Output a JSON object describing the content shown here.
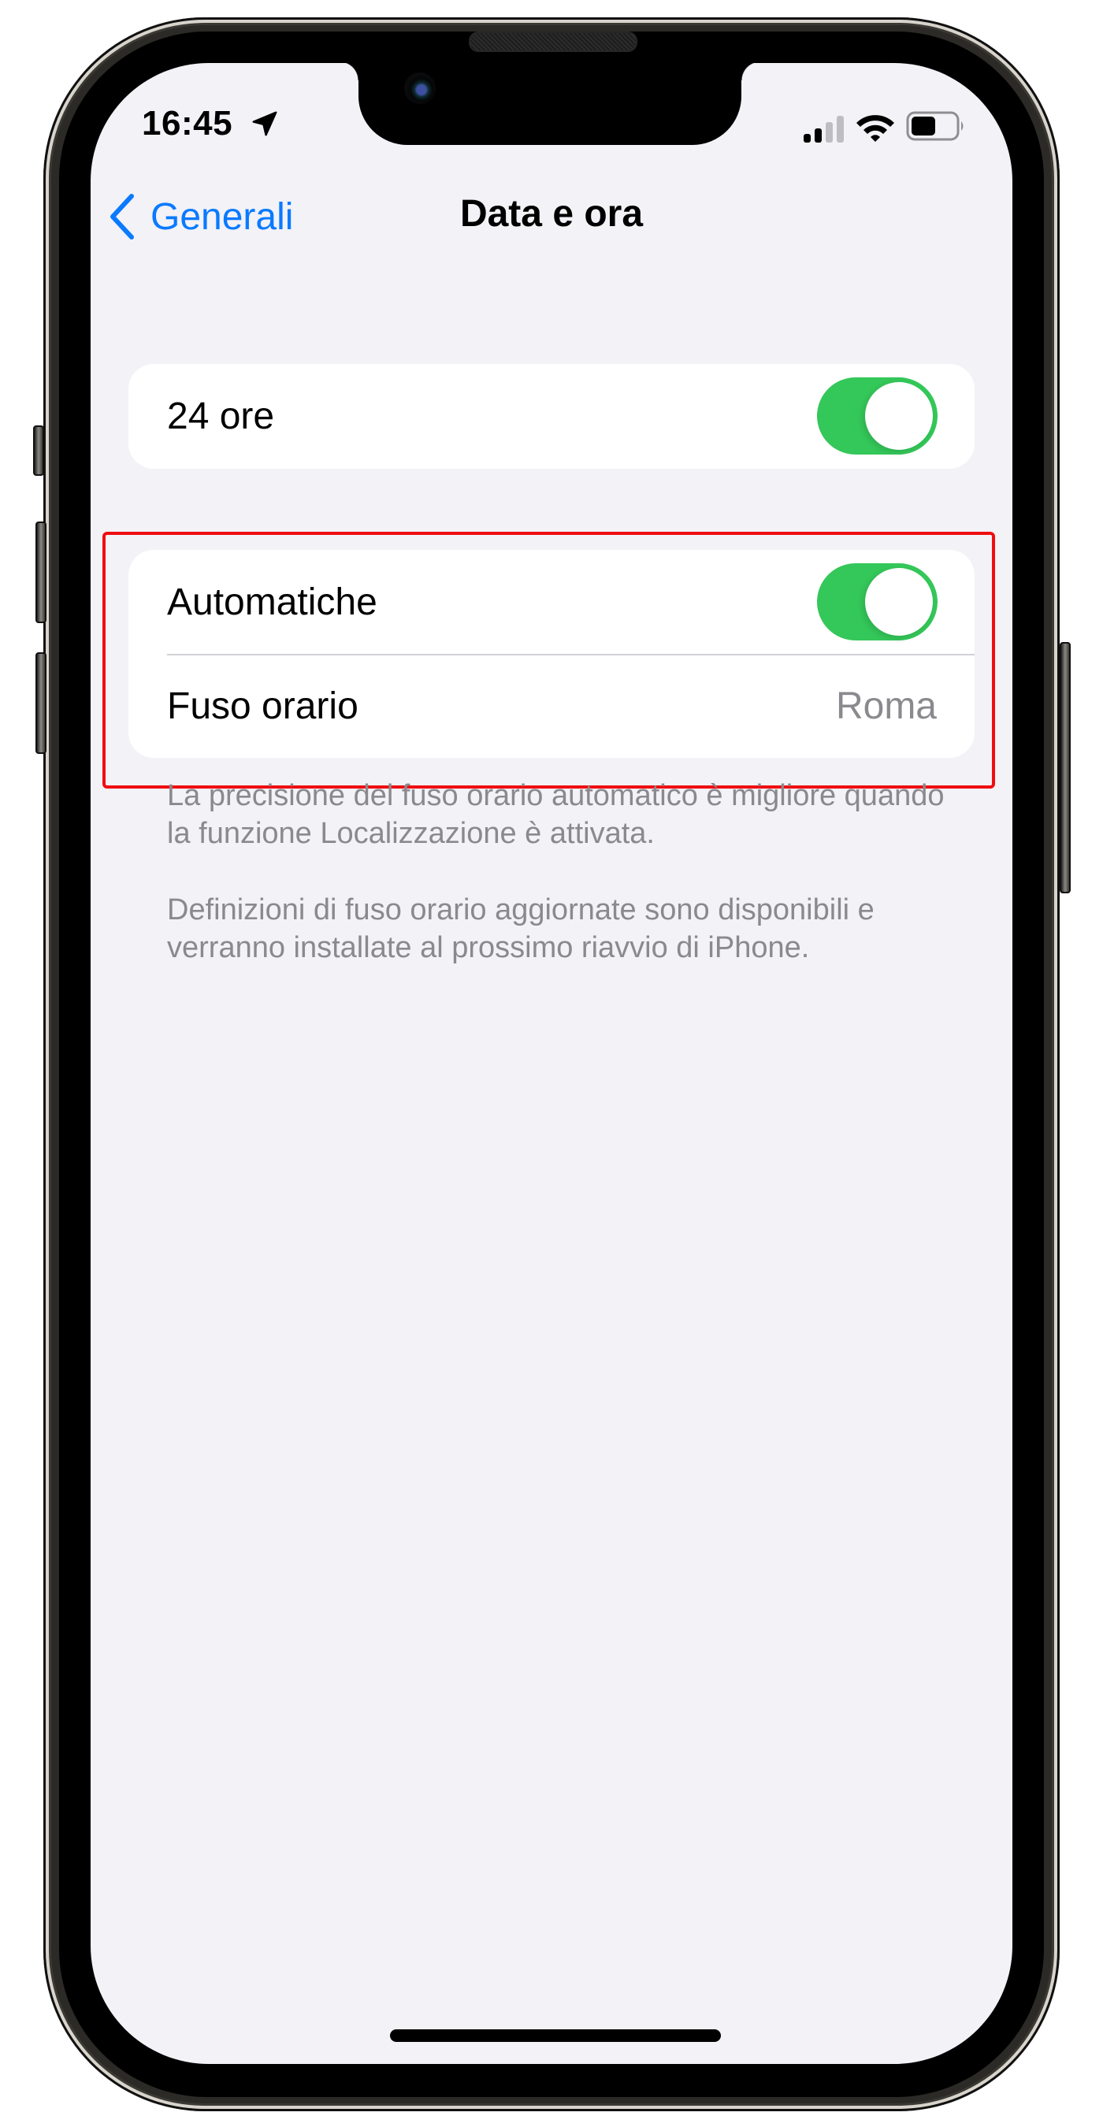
{
  "status_bar": {
    "time": "16:45",
    "location_icon": "location-arrow-icon",
    "signal_icon": "cellular-signal-icon",
    "signal_bars_active": 2,
    "signal_bars_total": 4,
    "wifi_icon": "wifi-icon",
    "battery_icon": "battery-icon",
    "battery_level": 0.5
  },
  "nav": {
    "back_label": "Generali",
    "back_icon": "chevron-left-icon",
    "title": "Data e ora"
  },
  "groups": [
    {
      "rows": [
        {
          "label": "24 ore",
          "type": "toggle",
          "on": true
        }
      ]
    },
    {
      "highlighted": true,
      "rows": [
        {
          "label": "Automatiche",
          "type": "toggle",
          "on": true
        },
        {
          "label": "Fuso orario",
          "type": "value",
          "value": "Roma"
        }
      ]
    }
  ],
  "footer_notes": [
    "La precisione del fuso orario automatico è migliore quando la funzione Localizzazione è attivata.",
    "Definizioni di fuso orario aggiornate sono disponibili e verranno installate al prossimo riavvio di iPhone."
  ],
  "colors": {
    "accent": "#0a7aff",
    "toggle_on": "#34c759",
    "background": "#f2f2f7",
    "secondary_text": "#8a8a8e",
    "highlight": "#ef0d11"
  }
}
